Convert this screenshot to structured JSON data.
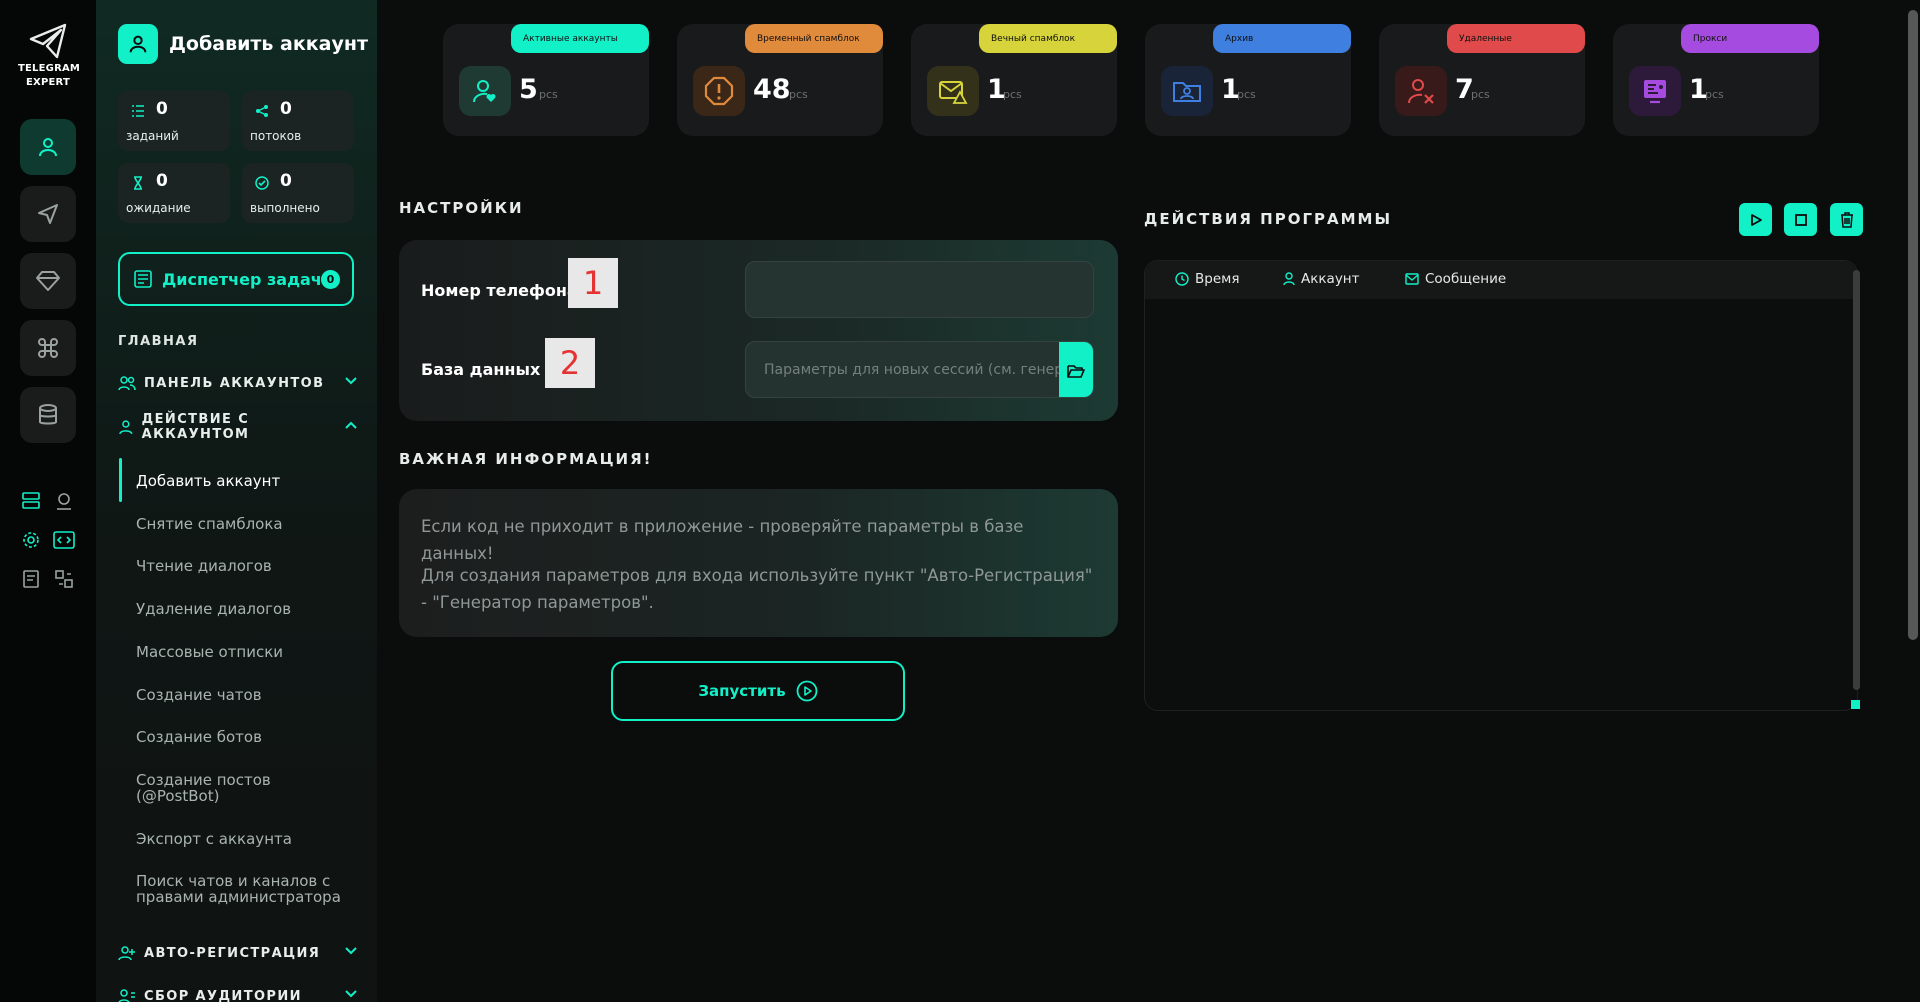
{
  "app": {
    "logo_line1": "TELEGRAM",
    "logo_line2": "EXPERT",
    "accent": "#12f0c8"
  },
  "rail": {
    "items": [
      "user-icon",
      "send-icon",
      "diamond-icon",
      "command-icon",
      "database-icon"
    ],
    "tools": [
      "storage-icon",
      "proxy-icon",
      "settings-icon",
      "code-icon",
      "doc-icon",
      "transfer-icon"
    ]
  },
  "sidebar": {
    "title": "Добавить аккаунт",
    "stats": [
      {
        "value": "0",
        "label": "заданий"
      },
      {
        "value": "0",
        "label": "потоков"
      },
      {
        "value": "0",
        "label": "ожидание"
      },
      {
        "value": "0",
        "label": "выполнено"
      }
    ],
    "dispatcher_label": "Диспетчер задач",
    "dispatcher_count": "0",
    "section_main": "ГЛАВНАЯ",
    "group_accounts": "ПАНЕЛЬ АККАУНТОВ",
    "group_action": "ДЕЙСТВИЕ С АККАУНТОМ",
    "menu": [
      "Добавить аккаунт",
      "Снятие спамблока",
      "Чтение диалогов",
      "Удаление диалогов",
      "Массовые отписки",
      "Создание чатов",
      "Создание ботов",
      "Создание постов (@PostBot)",
      "Экспорт с аккаунта",
      "Поиск чатов и каналов с правами администратора"
    ],
    "group_autoreg": "АВТО-РЕГИСТРАЦИЯ",
    "group_audience": "СБОР АУДИТОРИИ"
  },
  "cards": [
    {
      "tag": "Активные аккаунты",
      "count": "5",
      "unit": "pcs",
      "color": "#12f0c8"
    },
    {
      "tag": "Временный спамблок",
      "count": "48",
      "unit": "pcs",
      "color": "#e08a3c"
    },
    {
      "tag": "Вечный спамблок",
      "count": "1",
      "unit": "pcs",
      "color": "#d6d43a"
    },
    {
      "tag": "Архив",
      "count": "1",
      "unit": "pcs",
      "color": "#3f7fe0"
    },
    {
      "tag": "Удаленные",
      "count": "7",
      "unit": "pcs",
      "color": "#e04a4a"
    },
    {
      "tag": "Прокси",
      "count": "1",
      "unit": "pcs",
      "color": "#a64be0"
    }
  ],
  "settings": {
    "title": "НАСТРОЙКИ",
    "phone_label": "Номер телефона",
    "phone_badge": "1",
    "phone_value": "",
    "db_label": "База данных",
    "db_badge": "2",
    "db_placeholder": "Параметры для новых сессий (см. генератор"
  },
  "info": {
    "title": "ВАЖНАЯ ИНФОРМАЦИЯ!",
    "line1": "Если код не приходит в приложение - проверяйте параметры в базе данных!",
    "line2": "Для создания параметров для входа используйте пункт \"Авто-Регистрация\" - \"Генератор параметров\"."
  },
  "run_label": "Запустить",
  "log": {
    "title": "ДЕЙСТВИЯ ПРОГРАММЫ",
    "col_time": "Время",
    "col_account": "Аккаунт",
    "col_message": "Сообщение"
  }
}
